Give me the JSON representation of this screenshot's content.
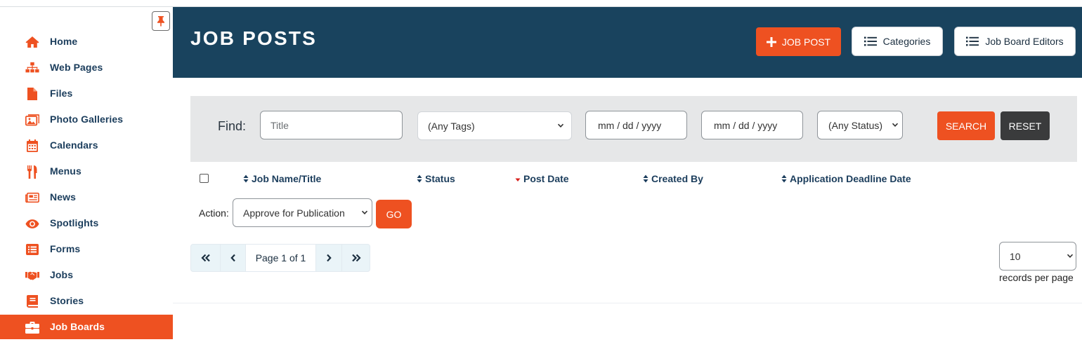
{
  "sidebar": {
    "pin_icon": "pin-icon",
    "items": [
      {
        "label": "Home",
        "icon": "home-icon"
      },
      {
        "label": "Web Pages",
        "icon": "sitemap-icon"
      },
      {
        "label": "Files",
        "icon": "file-icon"
      },
      {
        "label": "Photo Galleries",
        "icon": "images-icon"
      },
      {
        "label": "Calendars",
        "icon": "calendar-icon"
      },
      {
        "label": "Menus",
        "icon": "utensils-icon"
      },
      {
        "label": "News",
        "icon": "newspaper-icon"
      },
      {
        "label": "Spotlights",
        "icon": "eye-icon"
      },
      {
        "label": "Forms",
        "icon": "list-form-icon"
      },
      {
        "label": "Jobs",
        "icon": "handshake-icon"
      },
      {
        "label": "Stories",
        "icon": "book-icon"
      },
      {
        "label": "Job Boards",
        "icon": "briefcase-icon",
        "active": true
      }
    ]
  },
  "header": {
    "title": "JOB POSTS",
    "job_post_button": "JOB POST",
    "categories_button": "Categories",
    "editors_button": "Job Board Editors"
  },
  "find": {
    "label": "Find:",
    "title_placeholder": "Title",
    "tags_value": "(Any Tags)",
    "date_from_placeholder": "mm / dd / yyyy",
    "date_to_placeholder": "mm / dd / yyyy",
    "status_value": "(Any Status)",
    "search_button": "SEARCH",
    "reset_button": "RESET"
  },
  "table": {
    "columns": [
      {
        "label": "Job Name/Title",
        "sort": "none"
      },
      {
        "label": "Status",
        "sort": "none"
      },
      {
        "label": "Post Date",
        "sort": "desc"
      },
      {
        "label": "Created By",
        "sort": "none"
      },
      {
        "label": "Application Deadline Date",
        "sort": "none"
      }
    ]
  },
  "action": {
    "label": "Action:",
    "selected": "Approve for Publication",
    "go_button": "GO"
  },
  "pager": {
    "page_label": "Page 1 of 1"
  },
  "records": {
    "selected": "10",
    "label": "records per page"
  },
  "colors": {
    "accent": "#ee5121",
    "header_bg": "#19435e",
    "nav_text": "#1b3d5c"
  }
}
